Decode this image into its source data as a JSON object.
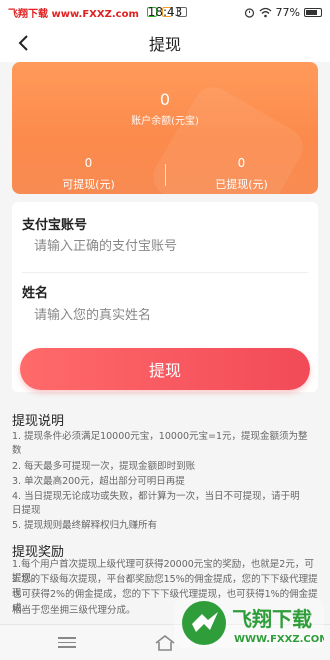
{
  "status": {
    "watermark": "飞翔下载 www.FXXZ.com",
    "time": "18:43",
    "battery": "77%"
  },
  "nav": {
    "title": "提现"
  },
  "hero": {
    "balance": "0",
    "balance_label": "账户余额(元宝)",
    "withdrawable_value": "0",
    "withdrawable_label": "可提现(元)",
    "withdrawn_value": "0",
    "withdrawn_label": "已提现(元)"
  },
  "form": {
    "alipay_label": "支付宝账号",
    "alipay_placeholder": "请输入正确的支付宝账号",
    "name_label": "姓名",
    "name_placeholder": "请输入您的真实姓名",
    "submit_label": "提现"
  },
  "instructions": {
    "title": "提现说明",
    "rules": [
      "1. 提现条件必须满足10000元宝，10000元宝=1元，提现金额须为整",
      "数",
      "2. 每天最多可提现一次，提现金额即时到账",
      "3. 单次最高200元，超出部分可明日再提",
      "4. 当日提现无论成功或失败，都计算为一次，当日不可提现，请于明",
      "日提现",
      "5. 提现规则最终解释权归九赚所有"
    ]
  },
  "rewards": {
    "title": "提现奖励",
    "rules": [
      "1.每个用户首次提现上级代理可获得20000元宝的奖励，也就是2元，可提现。",
      "2.您的下级每次提现，平台都奖励您15%的佣金提成，您的下下级代理提现",
      "也可获得2%的佣金提成，您的下下下级代理提现，也可获得1%的佣金提成。",
      "相当于您坐拥三级代理分成。"
    ]
  },
  "watermark_logo": {
    "text": "飞翔下载",
    "url": "WWW.FXXZ.COM"
  },
  "colors": {
    "accent": "#fb8a4c",
    "button": "#f24a58"
  }
}
